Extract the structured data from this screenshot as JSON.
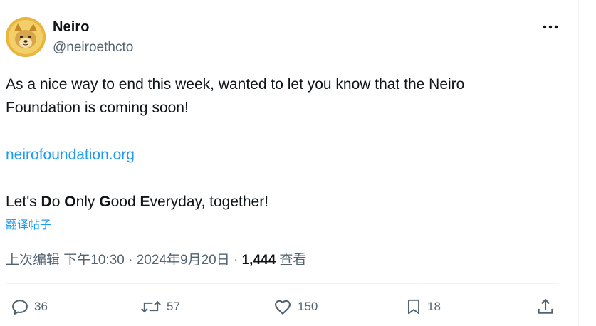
{
  "author": {
    "name": "Neiro",
    "handle": "@neiroethcto",
    "avatar_icon": "shiba-dog-avatar-icon"
  },
  "more_icon": "more-dots-icon",
  "tweet": {
    "line1": "As a nice way to end this week, wanted to let you know that the Neiro",
    "line2": "Foundation is coming soon!",
    "link": "neirofoundation.org",
    "closing_before_d": "Let's ",
    "d_bold": "D",
    "o_rest": "o ",
    "o_bold": "O",
    "nly_rest": "nly ",
    "g_bold": "G",
    "ood_rest": "ood ",
    "e_bold": "E",
    "tail": "veryday, together!"
  },
  "translate_label": "翻译帖子",
  "meta": {
    "edited": "上次编辑",
    "time": "下午10:30",
    "separator": " · ",
    "date": "2024年9月20日",
    "views_count": "1,444",
    "views_label": "查看"
  },
  "actions": {
    "replies": "36",
    "reposts": "57",
    "likes": "150",
    "bookmarks": "18"
  },
  "colors": {
    "link": "#1d9bf0",
    "secondary": "#536471",
    "text": "#0f1419"
  }
}
